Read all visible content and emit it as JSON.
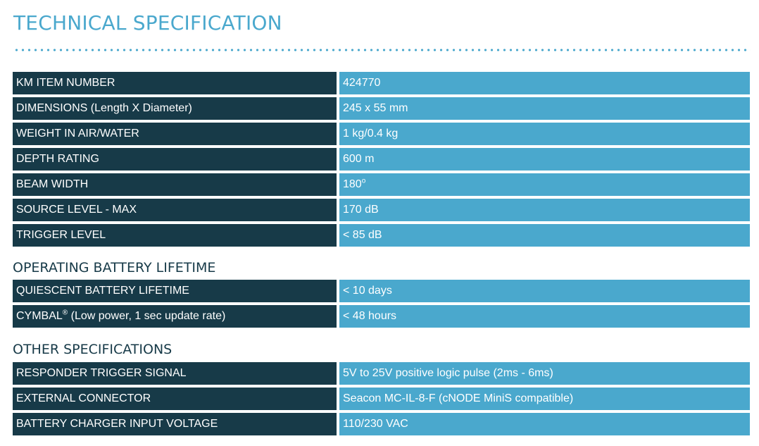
{
  "page_title": "TECHNICAL SPECIFICATION",
  "main_specs": [
    {
      "label": "KM ITEM NUMBER",
      "value": "424770"
    },
    {
      "label": "DIMENSIONS (Length X Diameter)",
      "value": "245 x 55 mm"
    },
    {
      "label": "WEIGHT IN AIR/WATER",
      "value": "1 kg/0.4 kg"
    },
    {
      "label": "DEPTH RATING",
      "value": "600 m"
    },
    {
      "label": "BEAM WIDTH",
      "value": "180",
      "value_sup": "o"
    },
    {
      "label": "SOURCE LEVEL - MAX",
      "value": "170 dB"
    },
    {
      "label": "TRIGGER LEVEL",
      "value": "< 85 dB"
    }
  ],
  "battery_section": {
    "heading": "OPERATING BATTERY LIFETIME",
    "rows": [
      {
        "label": "QUIESCENT BATTERY LIFETIME",
        "value": "< 10 days"
      },
      {
        "label_prefix": "CYMBAL",
        "label_sup": "®",
        "label_suffix": " (Low power, 1 sec update rate)",
        "value": "< 48 hours"
      }
    ]
  },
  "other_section": {
    "heading": "OTHER SPECIFICATIONS",
    "rows": [
      {
        "label": "RESPONDER TRIGGER SIGNAL",
        "value": "5V to 25V positive logic pulse (2ms - 6ms)"
      },
      {
        "label": "EXTERNAL CONNECTOR",
        "value": "Seacon MC-IL-8-F (cNODE MiniS compatible)"
      },
      {
        "label": "BATTERY CHARGER INPUT VOLTAGE",
        "value": "110/230 VAC"
      }
    ]
  },
  "colors": {
    "label_bg": "#173a48",
    "value_bg": "#4aa8cd",
    "title": "#4aa8cd",
    "heading": "#173a48"
  }
}
